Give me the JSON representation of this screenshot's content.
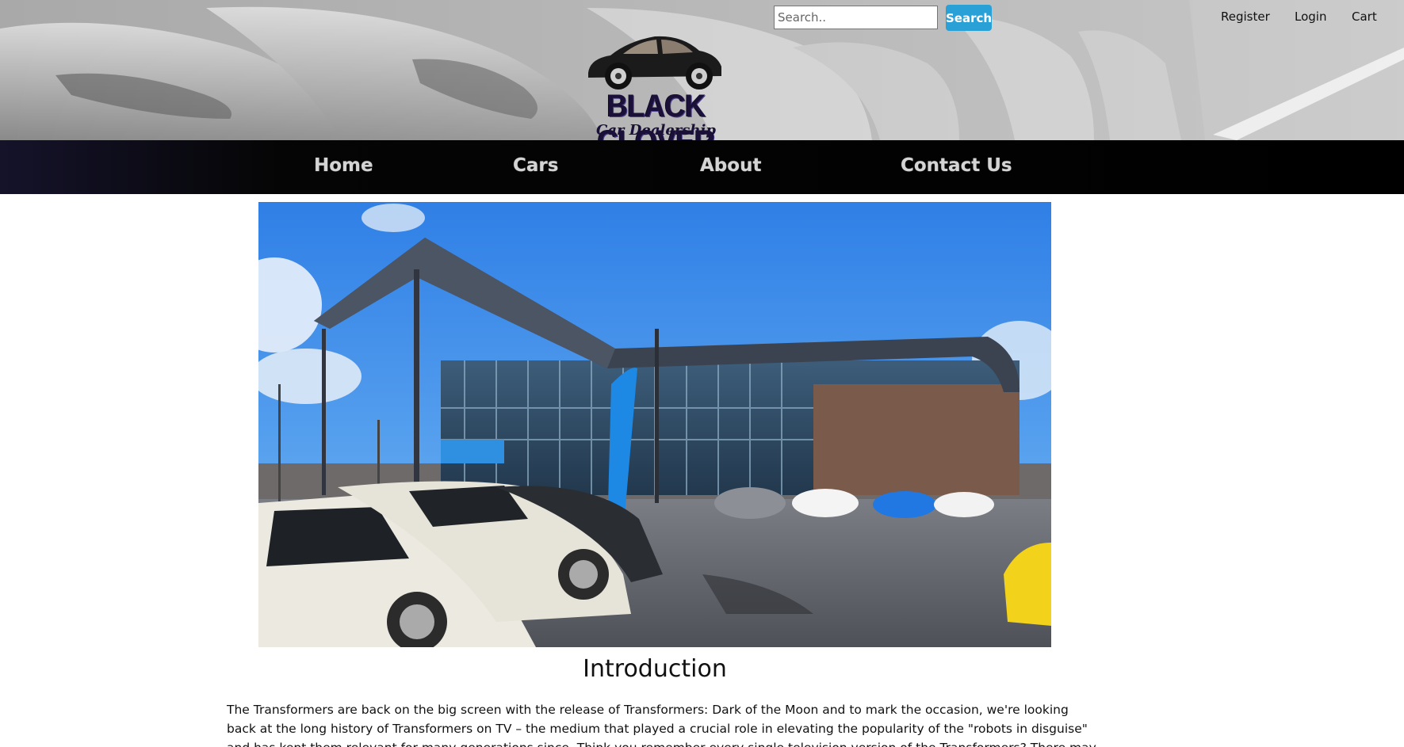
{
  "header": {
    "search": {
      "placeholder": "Search..",
      "button_label": "Search"
    },
    "account_links": {
      "register": "Register",
      "login": "Login",
      "cart": "Cart"
    },
    "logo": {
      "title": "BLACK CLOVER",
      "subtitle": "Car Dealership",
      "icon": "car-icon"
    }
  },
  "nav": {
    "items": [
      "Home",
      "Cars",
      "About",
      "Contact Us"
    ]
  },
  "main": {
    "hero_image": "dealership-building-photo",
    "section_title": "Introduction",
    "intro_text": "The Transformers are back on the big screen with the release of Transformers: Dark of the Moon and to mark the occasion, we're looking back at the long history of Transformers on TV – the medium that played a crucial role in elevating the popularity of the \"robots in disguise\" and has kept them relevant for many generations since. Think you remember every single television version of the Transformers? There may be a couple that fell off your radar."
  },
  "colors": {
    "search_button": "#2aa1d6",
    "navbar": "#000000",
    "nav_text": "#d4d4d4",
    "logo_text": "#1a1038"
  }
}
